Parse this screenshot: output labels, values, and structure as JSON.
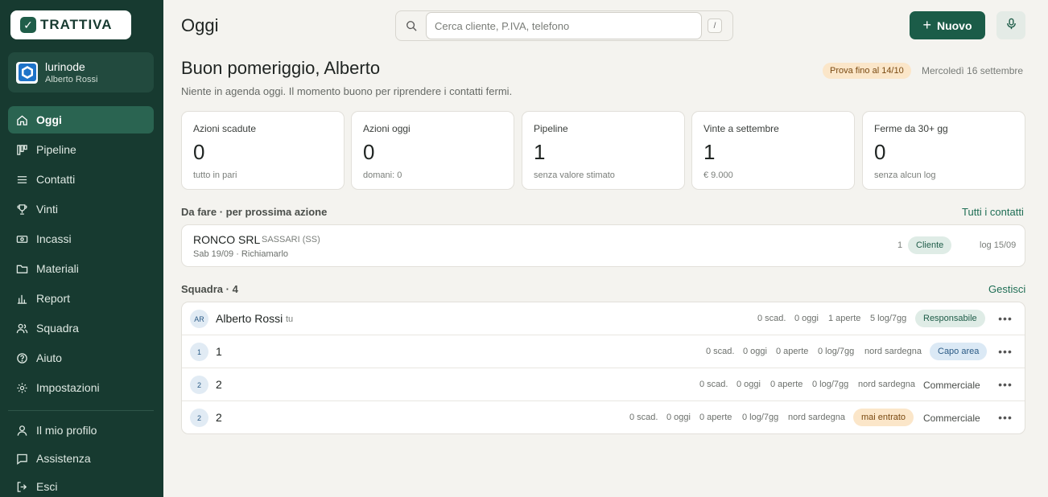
{
  "sidebar": {
    "logo": "TRATTIVA",
    "org": {
      "name": "lurinode",
      "user": "Alberto Rossi"
    },
    "nav": [
      {
        "label": "Oggi",
        "icon": "home-icon",
        "active": true
      },
      {
        "label": "Pipeline",
        "icon": "pipeline-icon"
      },
      {
        "label": "Contatti",
        "icon": "list-icon"
      },
      {
        "label": "Vinti",
        "icon": "trophy-icon"
      },
      {
        "label": "Incassi",
        "icon": "banknote-icon"
      },
      {
        "label": "Materiali",
        "icon": "folder-icon"
      },
      {
        "label": "Report",
        "icon": "bar-chart-icon"
      },
      {
        "label": "Squadra",
        "icon": "users-icon"
      },
      {
        "label": "Aiuto",
        "icon": "help-icon"
      },
      {
        "label": "Impostazioni",
        "icon": "gear-icon"
      }
    ],
    "bottom": [
      {
        "label": "Il mio profilo",
        "icon": "user-icon"
      },
      {
        "label": "Assistenza",
        "icon": "chat-icon"
      },
      {
        "label": "Esci",
        "icon": "logout-icon"
      }
    ]
  },
  "header": {
    "title": "Oggi",
    "search_placeholder": "Cerca cliente, P.IVA, telefono",
    "search_shortcut": "/",
    "new_button": "Nuovo"
  },
  "greeting": {
    "title": "Buon pomeriggio, Alberto",
    "subtitle": "Niente in agenda oggi. Il momento buono per riprendere i contatti fermi.",
    "trial": "Prova fino al 14/10",
    "date": "Mercoledì 16 settembre"
  },
  "stats": [
    {
      "label": "Azioni scadute",
      "value": "0",
      "sub": "tutto in pari"
    },
    {
      "label": "Azioni oggi",
      "value": "0",
      "sub": "domani: 0"
    },
    {
      "label": "Pipeline",
      "value": "1",
      "sub": "senza valore stimato"
    },
    {
      "label": "Vinte a settembre",
      "value": "1",
      "sub": "€ 9.000"
    },
    {
      "label": "Ferme da 30+ gg",
      "value": "0",
      "sub": "senza alcun log"
    }
  ],
  "todo": {
    "title": "Da fare · per prossima azione",
    "link": "Tutti i contatti",
    "items": [
      {
        "name": "RONCO SRL",
        "location": "SASSARI (SS)",
        "next": "Sab 19/09 · Richiamarlo",
        "count": "1",
        "tag": "Cliente",
        "log": "log 15/09"
      }
    ]
  },
  "team": {
    "title": "Squadra · 4",
    "link": "Gestisci",
    "members": [
      {
        "initials": "AR",
        "name": "Alberto Rossi",
        "you": "tu",
        "scad": "0 scad.",
        "oggi": "0 oggi",
        "aperte": "1 aperte",
        "log": "5 log/7gg",
        "area": "",
        "badge": "Responsabile",
        "role": ""
      },
      {
        "initials": "1",
        "name": "1",
        "you": "",
        "scad": "0 scad.",
        "oggi": "0 oggi",
        "aperte": "0 aperte",
        "log": "0 log/7gg",
        "area": "nord sardegna",
        "badge": "Capo area",
        "role": ""
      },
      {
        "initials": "2",
        "name": "2",
        "you": "",
        "scad": "0 scad.",
        "oggi": "0 oggi",
        "aperte": "0 aperte",
        "log": "0 log/7gg",
        "area": "nord sardegna",
        "badge": "",
        "role": "Commerciale"
      },
      {
        "initials": "2",
        "name": "2",
        "you": "",
        "scad": "0 scad.",
        "oggi": "0 oggi",
        "aperte": "0 aperte",
        "log": "0 log/7gg",
        "area": "nord sardegna",
        "badge": "mai entrato",
        "role": "Commerciale"
      }
    ]
  }
}
